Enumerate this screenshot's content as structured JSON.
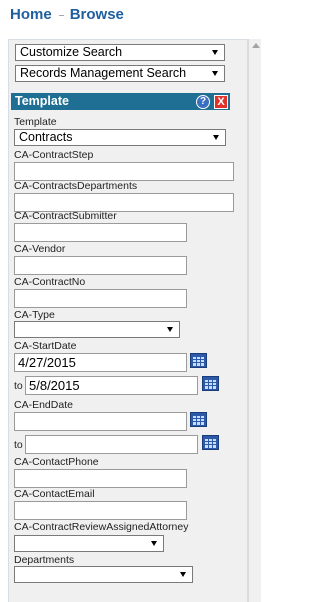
{
  "nav": {
    "home": "Home",
    "browse": "Browse"
  },
  "search_menus": {
    "customize": "Customize Search",
    "records": "Records Management Search"
  },
  "panel": {
    "title": "Template",
    "help_glyph": "?",
    "close_glyph": "X",
    "template_label": "Template",
    "template_value": "Contracts"
  },
  "fields": {
    "contract_step": "CA-ContractStep",
    "contracts_departments": "CA-ContractsDepartments",
    "contract_submitter": "CA-ContractSubmitter",
    "vendor": "CA-Vendor",
    "contract_no": "CA-ContractNo",
    "type": "CA-Type",
    "start_date": "CA-StartDate",
    "start_date_from": "4/27/2015",
    "to": "to",
    "start_date_to": "5/8/2015",
    "end_date": "CA-EndDate",
    "contact_phone": "CA-ContactPhone",
    "contact_email": "CA-ContactEmail",
    "review_attorney": "CA-ContractReviewAssignedAttorney",
    "departments": "Departments"
  },
  "icons": {
    "calendar": "calendar-icon",
    "help": "help-icon",
    "close": "close-icon",
    "dropdown": "chevron-down-icon"
  },
  "colors": {
    "nav": "#1f5fa0",
    "header": "#1e6f93",
    "close": "#e0322b",
    "help": "#3a6fc2"
  }
}
